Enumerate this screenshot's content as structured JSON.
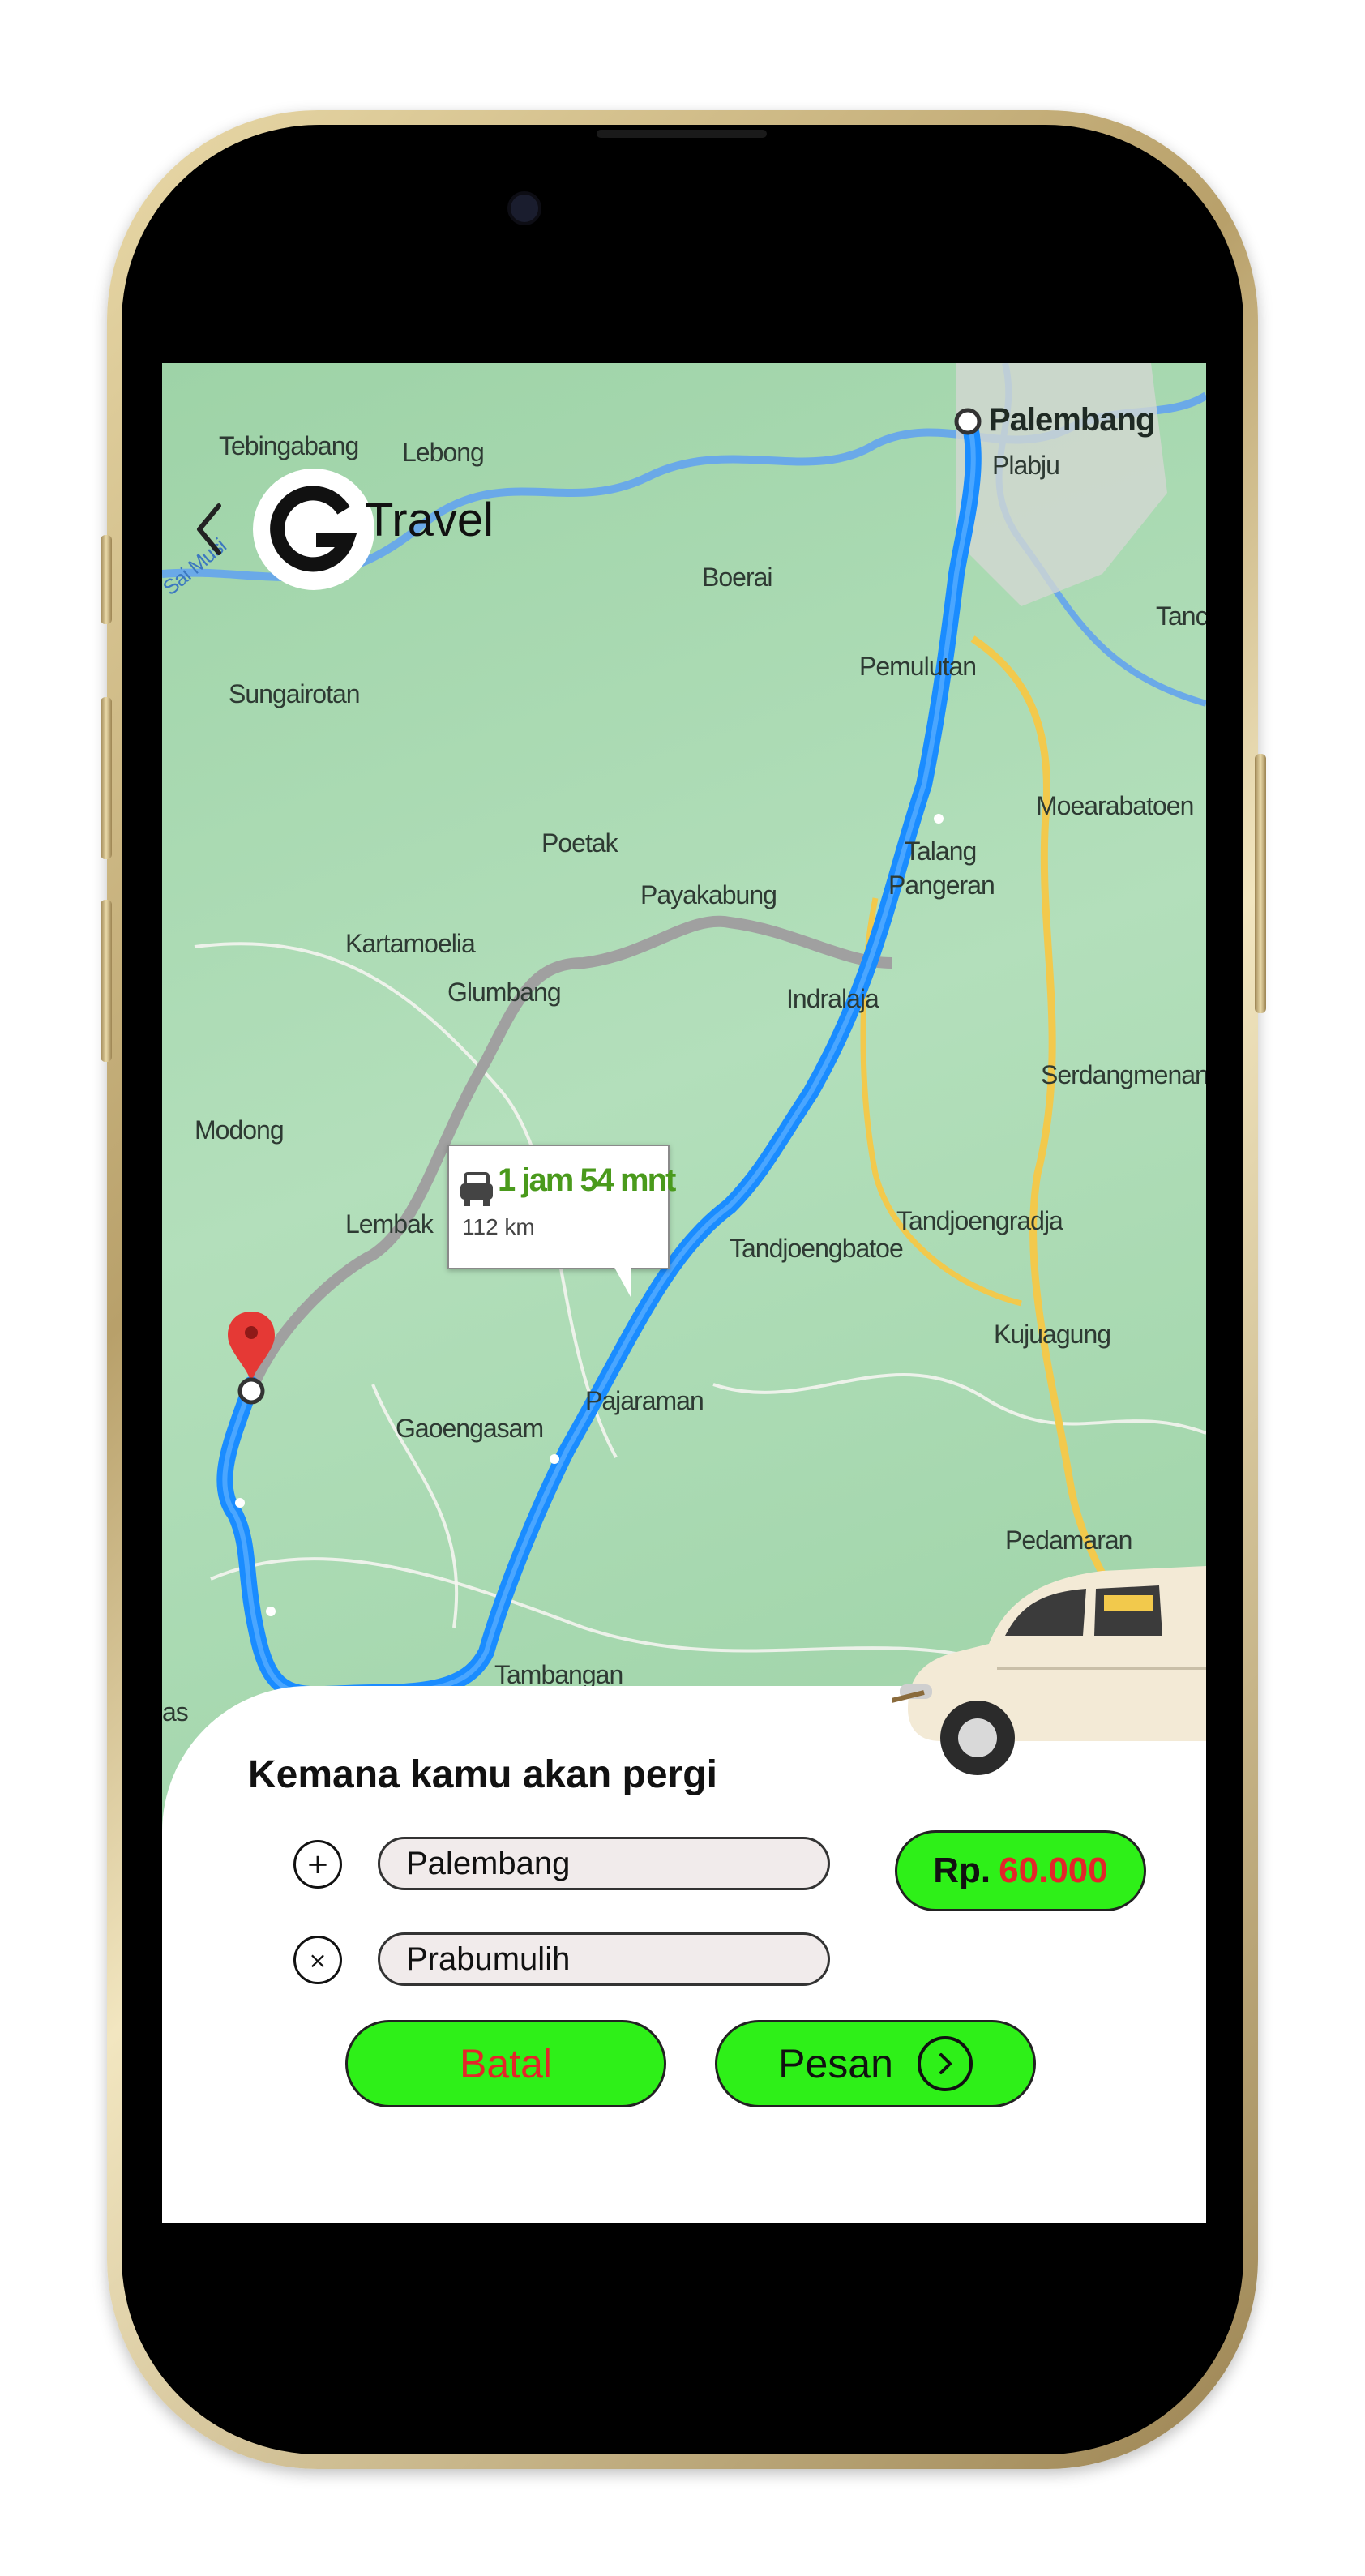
{
  "header": {
    "back_icon": "chevron-left-icon",
    "logo_letter": "G",
    "logo_text": "Travel"
  },
  "map": {
    "labels": [
      "Tebingabang",
      "Lebong",
      "Boerai",
      "Sungairotan",
      "Pemulutan",
      "Tanc",
      "Moearabatoen",
      "Poetak",
      "Talang",
      "Pangeran",
      "Payakabung",
      "Kartamoelia",
      "Glumbang",
      "Indralaja",
      "Serdangmenang",
      "Modong",
      "Lembak",
      "Tandjoengbatoe",
      "Tandjoengradja",
      "Kujuagung",
      "Gaoengasam",
      "Pajaraman",
      "Pedamaran",
      "Tambangan",
      "Plabju",
      "as",
      "Sai Musi"
    ],
    "origin_city": "Palembang",
    "route": {
      "duration": "1 jam 54 mnt",
      "distance": "112 km"
    },
    "colors": {
      "route": "#1a8cff",
      "alt_route": "#a0a0a0",
      "highway": "#f2c94c",
      "river": "#6aa9e8",
      "destination_pin": "#e53935"
    }
  },
  "booking": {
    "title": "Kemana kamu akan pergi",
    "origin_icon": "plus-circle-icon",
    "origin_value": "Palembang",
    "destination_icon": "close-circle-icon",
    "destination_value": "Prabumulih",
    "price_prefix": "Rp.",
    "price_amount": "60.000",
    "cancel_label": "Batal",
    "order_label": "Pesan",
    "order_icon": "chevron-right-circle-icon",
    "colors": {
      "button": "#2ef018",
      "price_text": "#e3262a",
      "cancel_text": "#e3262a"
    }
  }
}
